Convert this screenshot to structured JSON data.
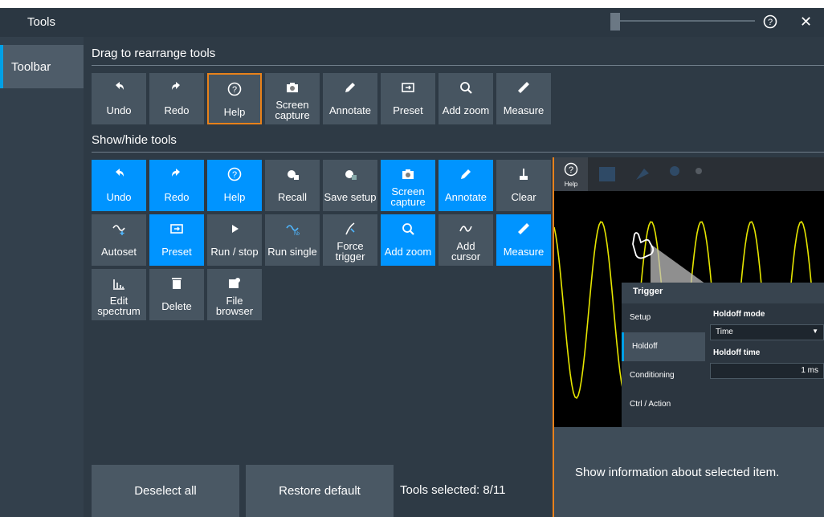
{
  "window": {
    "title": "Tools",
    "help_icon": "help-icon",
    "close_label": "✕"
  },
  "sidebar": {
    "items": [
      {
        "label": "Toolbar",
        "selected": true
      }
    ]
  },
  "sections": {
    "arrange_title": "Drag to rearrange tools",
    "showhide_title": "Show/hide tools"
  },
  "arrange_tools": [
    {
      "label": "Undo",
      "icon": "undo-icon"
    },
    {
      "label": "Redo",
      "icon": "redo-icon"
    },
    {
      "label": "Help",
      "icon": "help-icon",
      "highlighted": true
    },
    {
      "label": "Screen\ncapture",
      "icon": "camera-icon"
    },
    {
      "label": "Annotate",
      "icon": "pencil-icon"
    },
    {
      "label": "Preset",
      "icon": "preset-icon"
    },
    {
      "label": "Add zoom",
      "icon": "zoom-icon"
    },
    {
      "label": "Measure",
      "icon": "ruler-icon"
    }
  ],
  "showhide_tools": [
    {
      "label": "Undo",
      "icon": "undo-icon",
      "selected": true
    },
    {
      "label": "Redo",
      "icon": "redo-icon",
      "selected": true
    },
    {
      "label": "Help",
      "icon": "help-icon",
      "selected": true
    },
    {
      "label": "Recall",
      "icon": "recall-icon",
      "selected": false
    },
    {
      "label": "Save setup",
      "icon": "save-setup-icon",
      "selected": false
    },
    {
      "label": "Screen\ncapture",
      "icon": "camera-icon",
      "selected": true
    },
    {
      "label": "Annotate",
      "icon": "pencil-icon",
      "selected": true
    },
    {
      "label": "Clear",
      "icon": "clear-icon",
      "selected": false
    },
    {
      "label": "Autoset",
      "icon": "autoset-icon",
      "selected": false
    },
    {
      "label": "Preset",
      "icon": "preset-icon",
      "selected": true
    },
    {
      "label": "Run / stop",
      "icon": "play-icon",
      "selected": false
    },
    {
      "label": "Run single",
      "icon": "run-single-icon",
      "selected": false
    },
    {
      "label": "Force\ntrigger",
      "icon": "force-trigger-icon",
      "selected": false
    },
    {
      "label": "Add zoom",
      "icon": "zoom-icon",
      "selected": true
    },
    {
      "label": "Add\ncursor",
      "icon": "cursor-icon",
      "selected": false
    },
    {
      "label": "Measure",
      "icon": "ruler-icon",
      "selected": true
    },
    {
      "label": "Edit\nspectrum",
      "icon": "spectrum-icon",
      "selected": false
    },
    {
      "label": "Delete",
      "icon": "trash-icon",
      "selected": false
    },
    {
      "label": "File\nbrowser",
      "icon": "file-browser-icon",
      "selected": false
    }
  ],
  "buttons": {
    "deselect_all": "Deselect all",
    "restore_default": "Restore default"
  },
  "status": {
    "tools_selected": "Tools selected: 8/11"
  },
  "help_preview": {
    "help_caption": "Help",
    "dialog_title": "Trigger",
    "nav": [
      "Setup",
      "Holdoff",
      "Conditioning",
      "Ctrl / Action"
    ],
    "selected_nav": "Holdoff",
    "holdoff_mode_label": "Holdoff mode",
    "holdoff_mode_value": "Time",
    "holdoff_time_label": "Holdoff time",
    "holdoff_time_value": "1 ms",
    "description": "Show information about selected item."
  },
  "colors": {
    "accent_blue": "#0094ff",
    "highlight_orange": "#e8811a",
    "background": "#2e3a45",
    "tile_grey": "#475561",
    "waveform": "#e6e600"
  }
}
